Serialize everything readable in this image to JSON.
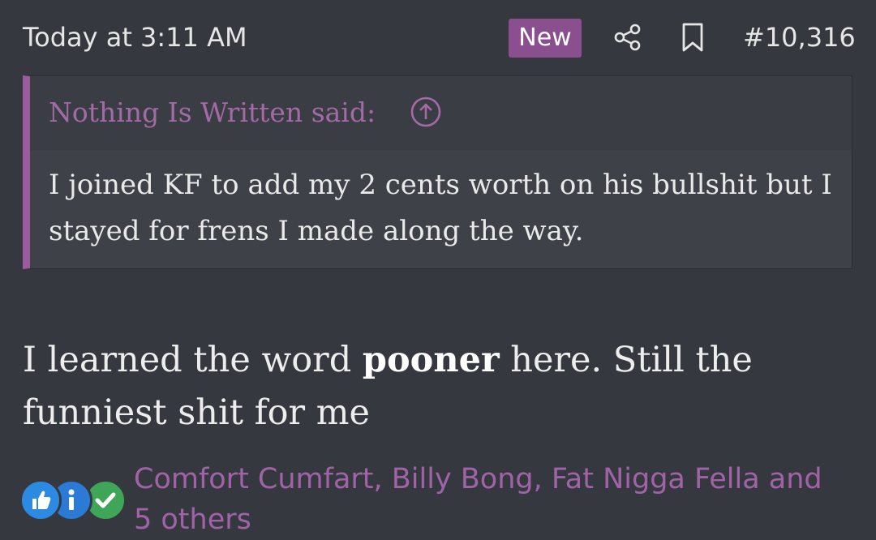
{
  "post": {
    "timestamp": "Today at 3:11 AM",
    "badge": "New",
    "number": "#10,316",
    "icons": [
      "share-icon",
      "bookmark-icon"
    ]
  },
  "quote": {
    "author_line": "Nothing Is Written said:",
    "text": "I joined KF to add my 2 cents worth on his bullshit but I stayed for frens I made along the way."
  },
  "message": {
    "before": "I learned the word ",
    "bold": "pooner",
    "after": " here. Still the funniest shit for me"
  },
  "reactions": {
    "icons": [
      "thumbs-up-icon",
      "info-icon",
      "check-icon"
    ],
    "summary": "Comfort Cumfart, Billy Bong, Fat Nigga Fella and 5 others"
  },
  "colors": {
    "background": "#363840",
    "accent": "#8a4f8f",
    "quote_bar": "#9a5c9c",
    "link": "#a064a6"
  }
}
